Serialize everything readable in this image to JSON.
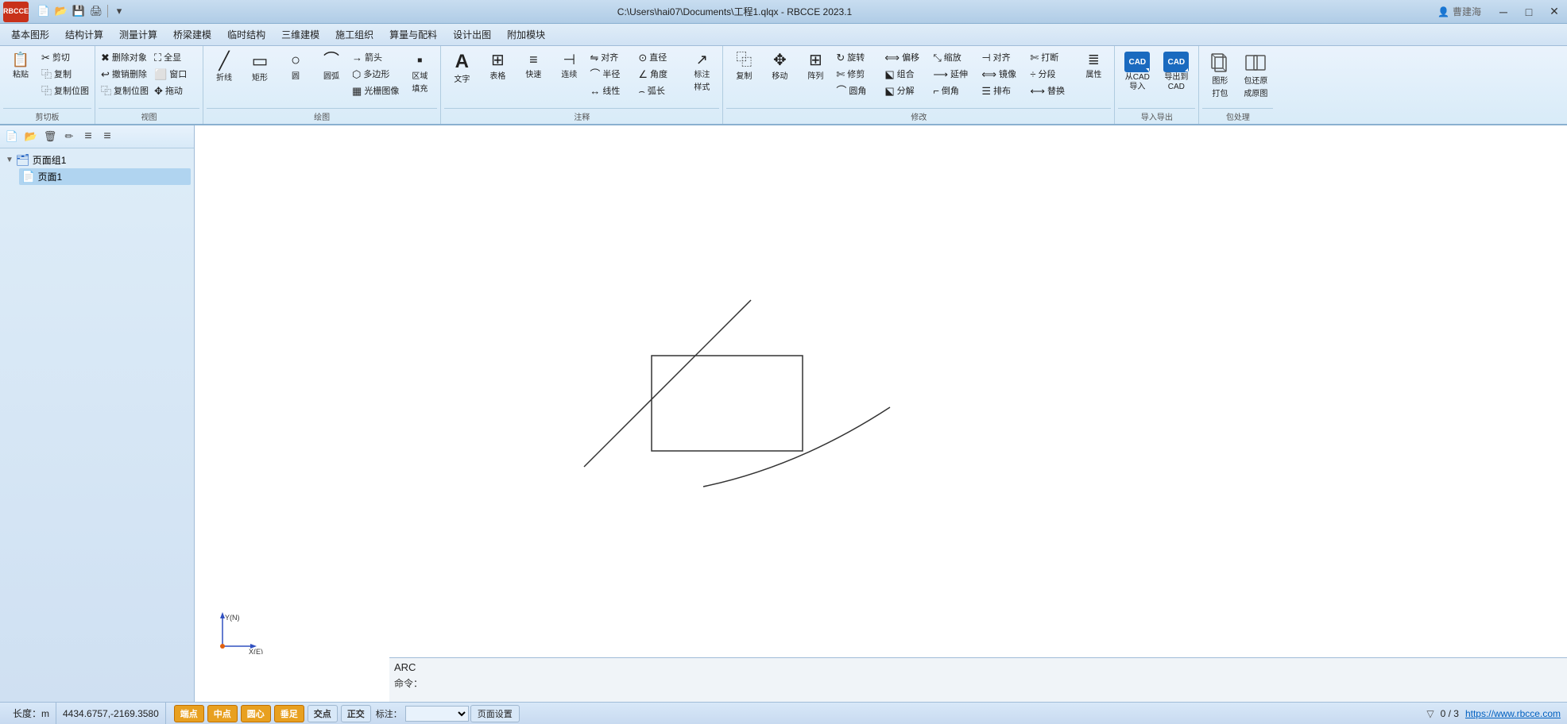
{
  "titlebar": {
    "logo_line1": "RB",
    "logo_line2": "CCE",
    "title": "C:\\Users\\hai07\\Documents\\工程1.qlqx - RBCCE 2023.1",
    "minimize": "─",
    "maximize": "□",
    "close": "✕",
    "user_icon": "👤",
    "user_name": "曹建海"
  },
  "quickbar": {
    "buttons": [
      {
        "name": "new-btn",
        "icon": "📄"
      },
      {
        "name": "open-btn",
        "icon": "📂"
      },
      {
        "name": "save-btn",
        "icon": "💾"
      },
      {
        "name": "print-btn",
        "icon": "🖨"
      },
      {
        "name": "dropdown-btn",
        "icon": "▾"
      }
    ]
  },
  "menubar": {
    "items": [
      "基本图形",
      "结构计算",
      "测量计算",
      "桥梁建模",
      "临时结构",
      "三维建模",
      "施工组织",
      "算量与配料",
      "设计出图",
      "附加模块"
    ]
  },
  "ribbon": {
    "groups": [
      {
        "label": "剪切板",
        "buttons": [
          {
            "name": "paste-btn",
            "icon": "📋",
            "label": "粘贴",
            "size": "large"
          },
          {
            "name": "cut-btn",
            "icon": "✂",
            "label": "剪切",
            "size": "small-top"
          },
          {
            "name": "copy-btn",
            "icon": "⿻",
            "label": "复制",
            "size": "small-mid"
          },
          {
            "name": "copyloc-btn",
            "icon": "⿻",
            "label": "复制位图",
            "size": "small-bot"
          }
        ]
      },
      {
        "label": "视图",
        "buttons": [
          {
            "name": "delete-btn",
            "icon": "✖",
            "label": "删除对象"
          },
          {
            "name": "undo-btn",
            "icon": "↩",
            "label": "撤销删除"
          },
          {
            "name": "copypos-btn",
            "icon": "⿻",
            "label": "复制位图"
          },
          {
            "name": "fullscreen-btn",
            "icon": "⛶",
            "label": "全显"
          },
          {
            "name": "window-btn",
            "icon": "⬜",
            "label": "窗口"
          },
          {
            "name": "drag-btn",
            "icon": "✥",
            "label": "拖动"
          }
        ]
      },
      {
        "label": "绘图",
        "buttons": [
          {
            "name": "line-btn",
            "icon": "╱",
            "label": "折线"
          },
          {
            "name": "rect-btn",
            "icon": "▭",
            "label": "矩形"
          },
          {
            "name": "circle-btn",
            "icon": "○",
            "label": "圆"
          },
          {
            "name": "arc-btn",
            "icon": "⌒",
            "label": "圆弧"
          },
          {
            "name": "arrow-btn",
            "icon": "→",
            "label": "箭头"
          },
          {
            "name": "polygon-btn",
            "icon": "⬡",
            "label": "多边形"
          },
          {
            "name": "gridfill-btn",
            "icon": "▦",
            "label": "光栅图像"
          },
          {
            "name": "areafill-btn",
            "icon": "▪",
            "label": "区域填充"
          }
        ]
      },
      {
        "label": "注释",
        "buttons": [
          {
            "name": "text-btn",
            "icon": "A",
            "label": "文字"
          },
          {
            "name": "table-btn",
            "icon": "⊞",
            "label": "表格"
          },
          {
            "name": "fast-btn",
            "icon": "≡",
            "label": "快速"
          },
          {
            "name": "connect-btn",
            "icon": "⊣",
            "label": "连续"
          },
          {
            "name": "align-btn",
            "icon": "⇋",
            "label": "对齐"
          },
          {
            "name": "halfrad-btn",
            "icon": "⌒",
            "label": "半径"
          },
          {
            "name": "linedim-btn",
            "icon": "↔",
            "label": "线性"
          },
          {
            "name": "diam-btn",
            "icon": "⊙",
            "label": "直径"
          },
          {
            "name": "angle-btn",
            "icon": "∠",
            "label": "角度"
          },
          {
            "name": "arclen-btn",
            "icon": "⌢",
            "label": "弧长"
          },
          {
            "name": "mark-btn",
            "icon": "↗",
            "label": "标注"
          },
          {
            "name": "markstyle-btn",
            "icon": "⚙",
            "label": "样式"
          }
        ]
      },
      {
        "label": "修改",
        "buttons": [
          {
            "name": "copy2-btn",
            "icon": "⿻",
            "label": "复制"
          },
          {
            "name": "move-btn",
            "icon": "✥",
            "label": "移动"
          },
          {
            "name": "array-btn",
            "icon": "⊞",
            "label": "阵列"
          },
          {
            "name": "rotate-btn",
            "icon": "↻",
            "label": "旋转"
          },
          {
            "name": "trim-btn",
            "icon": "✄",
            "label": "修剪"
          },
          {
            "name": "round-btn",
            "icon": "⌒",
            "label": "圆角"
          },
          {
            "name": "offset-btn",
            "icon": "⟺",
            "label": "偏移"
          },
          {
            "name": "group-btn",
            "icon": "⬕",
            "label": "组合"
          },
          {
            "name": "scale-btn",
            "icon": "⤡",
            "label": "缩放"
          },
          {
            "name": "extend-btn",
            "icon": "⟶",
            "label": "延伸"
          },
          {
            "name": "chamfer-btn",
            "icon": "⌐",
            "label": "倒角"
          },
          {
            "name": "align2-btn",
            "icon": "⊣",
            "label": "对齐"
          },
          {
            "name": "mirror-btn",
            "icon": "⟺",
            "label": "镜像"
          },
          {
            "name": "break-btn",
            "icon": "✄",
            "label": "打断"
          },
          {
            "name": "divide-btn",
            "icon": "÷",
            "label": "分段"
          },
          {
            "name": "replace-btn",
            "icon": "⟷",
            "label": "替换"
          },
          {
            "name": "ungroup-btn",
            "icon": "⬕",
            "label": "分解"
          },
          {
            "name": "arrange-btn",
            "icon": "☰",
            "label": "排布"
          },
          {
            "name": "props-btn",
            "icon": "≣",
            "label": "属性"
          }
        ]
      },
      {
        "label": "导入导出",
        "buttons": [
          {
            "name": "cad-import-btn",
            "label": "从CAD\n导入"
          },
          {
            "name": "cad-export-btn",
            "label": "导出到\nCAD"
          }
        ]
      },
      {
        "label": "包处理",
        "buttons": [
          {
            "name": "pack-btn",
            "label": "图形\n打包"
          },
          {
            "name": "restore-btn",
            "label": "包还原\n成原图"
          }
        ]
      }
    ]
  },
  "leftpanel": {
    "toolbar": {
      "buttons": [
        {
          "name": "lp-new",
          "icon": "📄"
        },
        {
          "name": "lp-open",
          "icon": "📂"
        },
        {
          "name": "lp-delete",
          "icon": "🗑"
        },
        {
          "name": "lp-edit",
          "icon": "✏"
        },
        {
          "name": "lp-up",
          "icon": "↑"
        },
        {
          "name": "lp-down",
          "icon": "↓"
        }
      ]
    },
    "tree": {
      "groups": [
        {
          "name": "页面组1",
          "expanded": true,
          "pages": [
            {
              "name": "页面1",
              "selected": true
            }
          ]
        }
      ]
    }
  },
  "canvas": {
    "arc_label": "ARC",
    "command_prompt": "命令："
  },
  "statusbar": {
    "length_label": "长度：m",
    "coordinates": "4434.6757,-2169.3580",
    "snap_buttons": [
      {
        "label": "端点",
        "active": true
      },
      {
        "label": "中点",
        "active": true
      },
      {
        "label": "圆心",
        "active": true
      },
      {
        "label": "垂足",
        "active": true
      },
      {
        "label": "交点",
        "active": false
      },
      {
        "label": "正交",
        "active": false
      },
      {
        "label": "标注：",
        "active": false
      }
    ],
    "page_setting": "页面设置",
    "count": "0 / 3",
    "website": "https://www.rbcce.com"
  }
}
